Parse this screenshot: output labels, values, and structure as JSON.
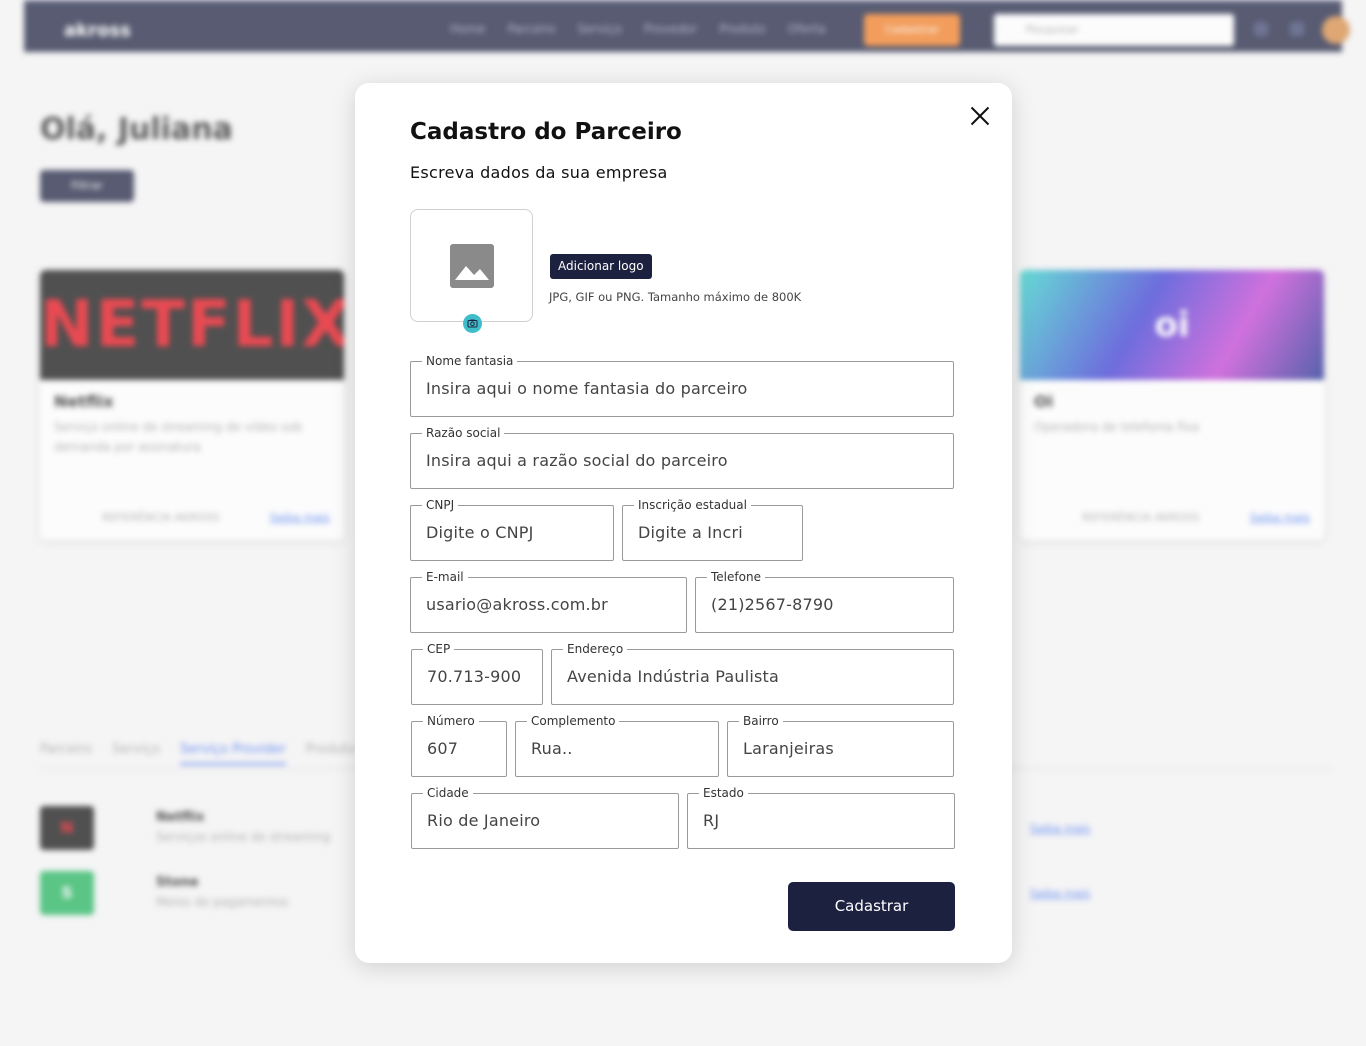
{
  "background": {
    "logo": "akross",
    "nav": [
      "Home",
      "Parceiro",
      "Serviço",
      "Provedor",
      "Produto",
      "Oferta"
    ],
    "nav_cta": "Cadastrar",
    "search_placeholder": "Pesquisar",
    "greeting": "Olá, Juliana",
    "action_button": "Filtrar",
    "cards": [
      {
        "image_text": "NETFLIX",
        "title": "Netflix",
        "description": "Serviço online de streaming de vídeo sob demanda por assinatura",
        "footer": "REFERÊNCIA AKROSS",
        "link": "Saiba mais"
      },
      {
        "image_text": "oi",
        "title": "Oi",
        "description": "Operadora de telefonia fixa",
        "footer": "REFERÊNCIA AKROSS",
        "link": "Saiba mais"
      }
    ],
    "tabs": [
      "Parceiro",
      "Serviço",
      "Serviço Provider",
      "Produto"
    ],
    "rows": [
      {
        "logo": "N",
        "title": "Netflix",
        "description": "Serviços online de streaming",
        "link": "Saiba mais",
        "color": "#111111"
      },
      {
        "logo": "S",
        "title": "Stone",
        "description": "Meios de pagamentos",
        "link": "Saiba mais",
        "color": "#1fb35a"
      }
    ]
  },
  "modal": {
    "title": "Cadastro do Parceiro",
    "subtitle": "Escreva dados da sua empresa",
    "add_logo_button": "Adicionar logo",
    "logo_hint": "JPG, GIF ou PNG. Tamanho máximo de 800K",
    "fields": {
      "nome_fantasia": {
        "label": "Nome fantasia",
        "value": "Insira aqui o nome fantasia do parceiro"
      },
      "razao_social": {
        "label": "Razão social",
        "value": "Insira aqui a razão social do parceiro"
      },
      "cnpj": {
        "label": "CNPJ",
        "value": "Digite o CNPJ"
      },
      "inscricao_estadual": {
        "label": "Inscrição estadual",
        "value": "Digite a Incri"
      },
      "email": {
        "label": "E-mail",
        "value": "usario@akross.com.br"
      },
      "telefone": {
        "label": "Telefone",
        "value": "(21)2567-8790"
      },
      "cep": {
        "label": "CEP",
        "value": "70.713-900"
      },
      "endereco": {
        "label": "Endereço",
        "value": "Avenida Indústria Paulista"
      },
      "numero": {
        "label": "Número",
        "value": "607"
      },
      "complemento": {
        "label": "Complemento",
        "value": "Rua.."
      },
      "bairro": {
        "label": "Bairro",
        "value": "Laranjeiras"
      },
      "cidade": {
        "label": "Cidade",
        "value": "Rio de Janeiro"
      },
      "estado": {
        "label": "Estado",
        "value": "RJ"
      }
    },
    "submit_button": "Cadastrar"
  },
  "colors": {
    "primary": "#1c2140",
    "accent": "#f27c21",
    "camera_badge": "#3fbdc8",
    "link": "#3a6cf0"
  },
  "icons": [
    "close-icon",
    "image-placeholder-icon",
    "camera-icon",
    "search-icon"
  ]
}
